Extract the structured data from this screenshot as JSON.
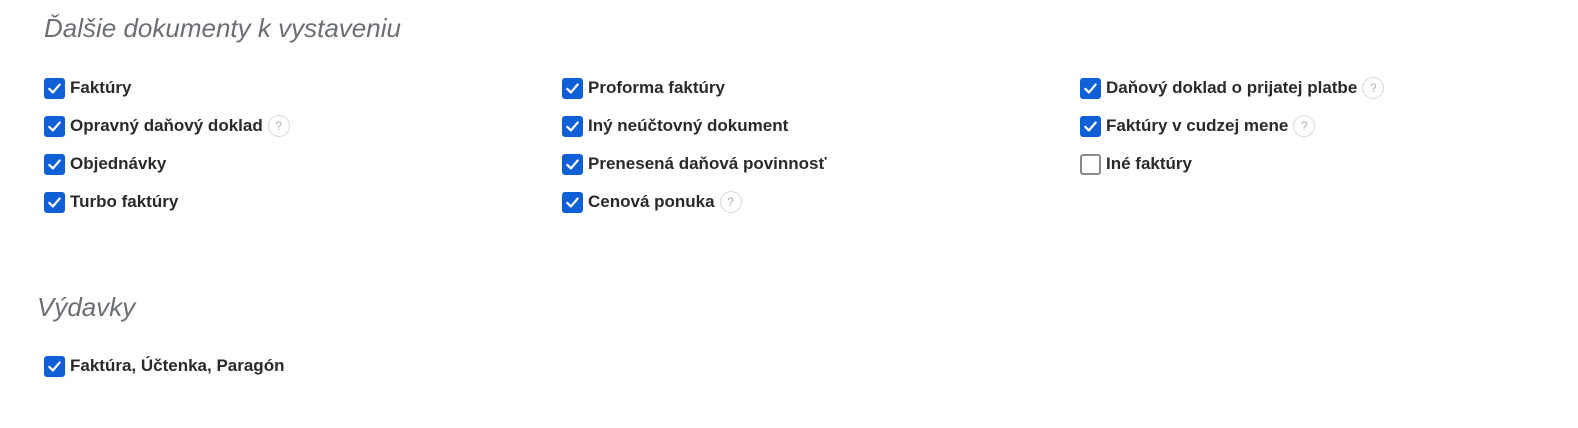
{
  "sections": [
    {
      "title": "Ďalšie dokumenty k vystaveniu",
      "items": [
        {
          "label": "Faktúry",
          "checked": true,
          "help": false
        },
        {
          "label": "Opravný daňový doklad",
          "checked": true,
          "help": true
        },
        {
          "label": "Objednávky",
          "checked": true,
          "help": false
        },
        {
          "label": "Turbo faktúry",
          "checked": true,
          "help": false
        },
        {
          "label": "Proforma faktúry",
          "checked": true,
          "help": false
        },
        {
          "label": "Iný neúčtovný dokument",
          "checked": true,
          "help": false
        },
        {
          "label": "Prenesená daňová povinnosť",
          "checked": true,
          "help": false
        },
        {
          "label": "Cenová ponuka",
          "checked": true,
          "help": true
        },
        {
          "label": "Daňový doklad o prijatej platbe",
          "checked": true,
          "help": true
        },
        {
          "label": "Faktúry v cudzej mene",
          "checked": true,
          "help": true
        },
        {
          "label": "Iné faktúry",
          "checked": false,
          "help": false
        }
      ]
    },
    {
      "title": "Výdavky",
      "items": [
        {
          "label": "Faktúra, Účtenka, Paragón",
          "checked": true,
          "help": false
        }
      ]
    }
  ],
  "help_glyph": "?",
  "icons": {
    "checkbox_checked": "checkmark-icon",
    "help": "question-mark-icon"
  },
  "colors": {
    "accent": "#0f5fd7",
    "title": "#6b6f73",
    "label": "#2a2a2a",
    "unchecked_border": "#8a8a8e"
  }
}
